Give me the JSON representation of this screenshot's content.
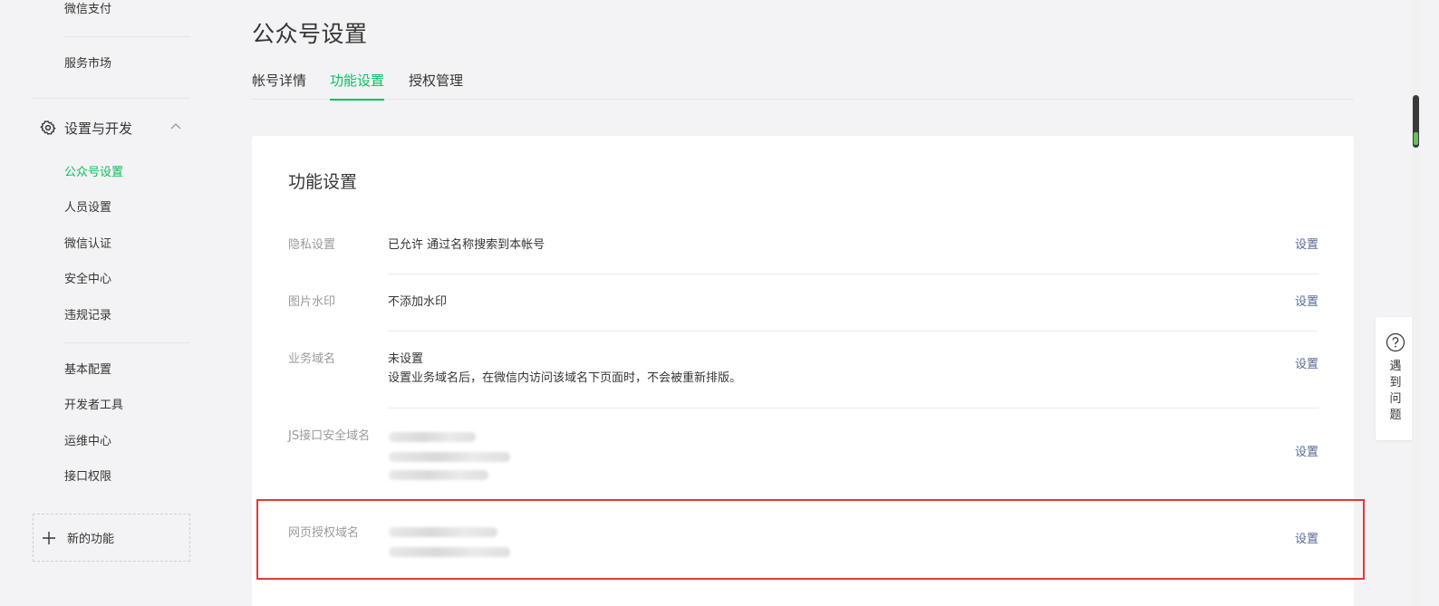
{
  "sidebar": {
    "top_items": [
      "微信支付",
      "服务市场"
    ],
    "section_title": "设置与开发",
    "section_items": [
      "公众号设置",
      "人员设置",
      "微信认证",
      "安全中心",
      "违规记录"
    ],
    "dev_items": [
      "基本配置",
      "开发者工具",
      "运维中心",
      "接口权限"
    ],
    "new_feature": "新的功能"
  },
  "page": {
    "title": "公众号设置",
    "tabs": [
      "帐号详情",
      "功能设置",
      "授权管理"
    ],
    "active_tab": "功能设置"
  },
  "card": {
    "title": "功能设置",
    "rows": [
      {
        "label": "隐私设置",
        "value": "已允许 通过名称搜索到本帐号",
        "action": "设置"
      },
      {
        "label": "图片水印",
        "value": "不添加水印",
        "action": "设置"
      },
      {
        "label": "业务域名",
        "value": "未设置",
        "note": "设置业务域名后，在微信内访问该域名下页面时，不会被重新排版。",
        "action": "设置"
      },
      {
        "label": "JS接口安全域名",
        "action": "设置"
      },
      {
        "label": "网页授权域名",
        "action": "设置"
      }
    ]
  },
  "helper": {
    "text": "遇到问题"
  },
  "colors": {
    "accent": "#07c160",
    "link": "#576b95",
    "highlight": "#e53935"
  }
}
